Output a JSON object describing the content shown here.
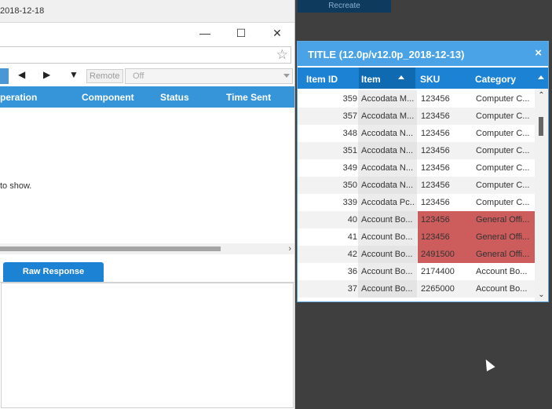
{
  "recreate_tab": "Recreate",
  "left_window": {
    "title_date": "2018-12-18",
    "window_controls": {
      "minimize": "—",
      "maximize": "☐",
      "close": "✕"
    },
    "toolbar": {
      "remote_label": "Remote",
      "remote_value": "Off"
    },
    "columns": [
      "peration",
      "Component",
      "Status",
      "Time Sent"
    ],
    "empty_message": "to show.",
    "tab_raw_response": "Raw Response"
  },
  "popup": {
    "title": "TITLE (12.0p/v12.0p_2018-12-13)",
    "close": "×",
    "columns": [
      "Item ID",
      "Item",
      "SKU",
      "Category"
    ],
    "rows": [
      {
        "id": "359",
        "item": "Accodata M...",
        "sku": "123456",
        "category": "Computer C..."
      },
      {
        "id": "357",
        "item": "Accodata M...",
        "sku": "123456",
        "category": "Computer C..."
      },
      {
        "id": "348",
        "item": "Accodata N...",
        "sku": "123456",
        "category": "Computer C..."
      },
      {
        "id": "351",
        "item": "Accodata N...",
        "sku": "123456",
        "category": "Computer C..."
      },
      {
        "id": "349",
        "item": "Accodata N...",
        "sku": "123456",
        "category": "Computer C..."
      },
      {
        "id": "350",
        "item": "Accodata N...",
        "sku": "123456",
        "category": "Computer C..."
      },
      {
        "id": "339",
        "item": "Accodata Pc...",
        "sku": "123456",
        "category": "Computer C..."
      },
      {
        "id": "40",
        "item": "Account Bo...",
        "sku": "123456",
        "category": "General Offi...",
        "highlight": true
      },
      {
        "id": "41",
        "item": "Account Bo...",
        "sku": "123456",
        "category": "General Offi...",
        "highlight": true
      },
      {
        "id": "42",
        "item": "Account Bo...",
        "sku": "2491500",
        "category": "General Offi...",
        "highlight": true
      },
      {
        "id": "36",
        "item": "Account Bo...",
        "sku": "2174400",
        "category": "Account Bo..."
      },
      {
        "id": "37",
        "item": "Account Bo...",
        "sku": "2265000",
        "category": "Account Bo..."
      }
    ]
  },
  "colors": {
    "accent": "#1c82d4",
    "title_blue": "#4aa3e6",
    "highlight": "#cd5c5c",
    "backdrop": "#3f3f3f"
  }
}
